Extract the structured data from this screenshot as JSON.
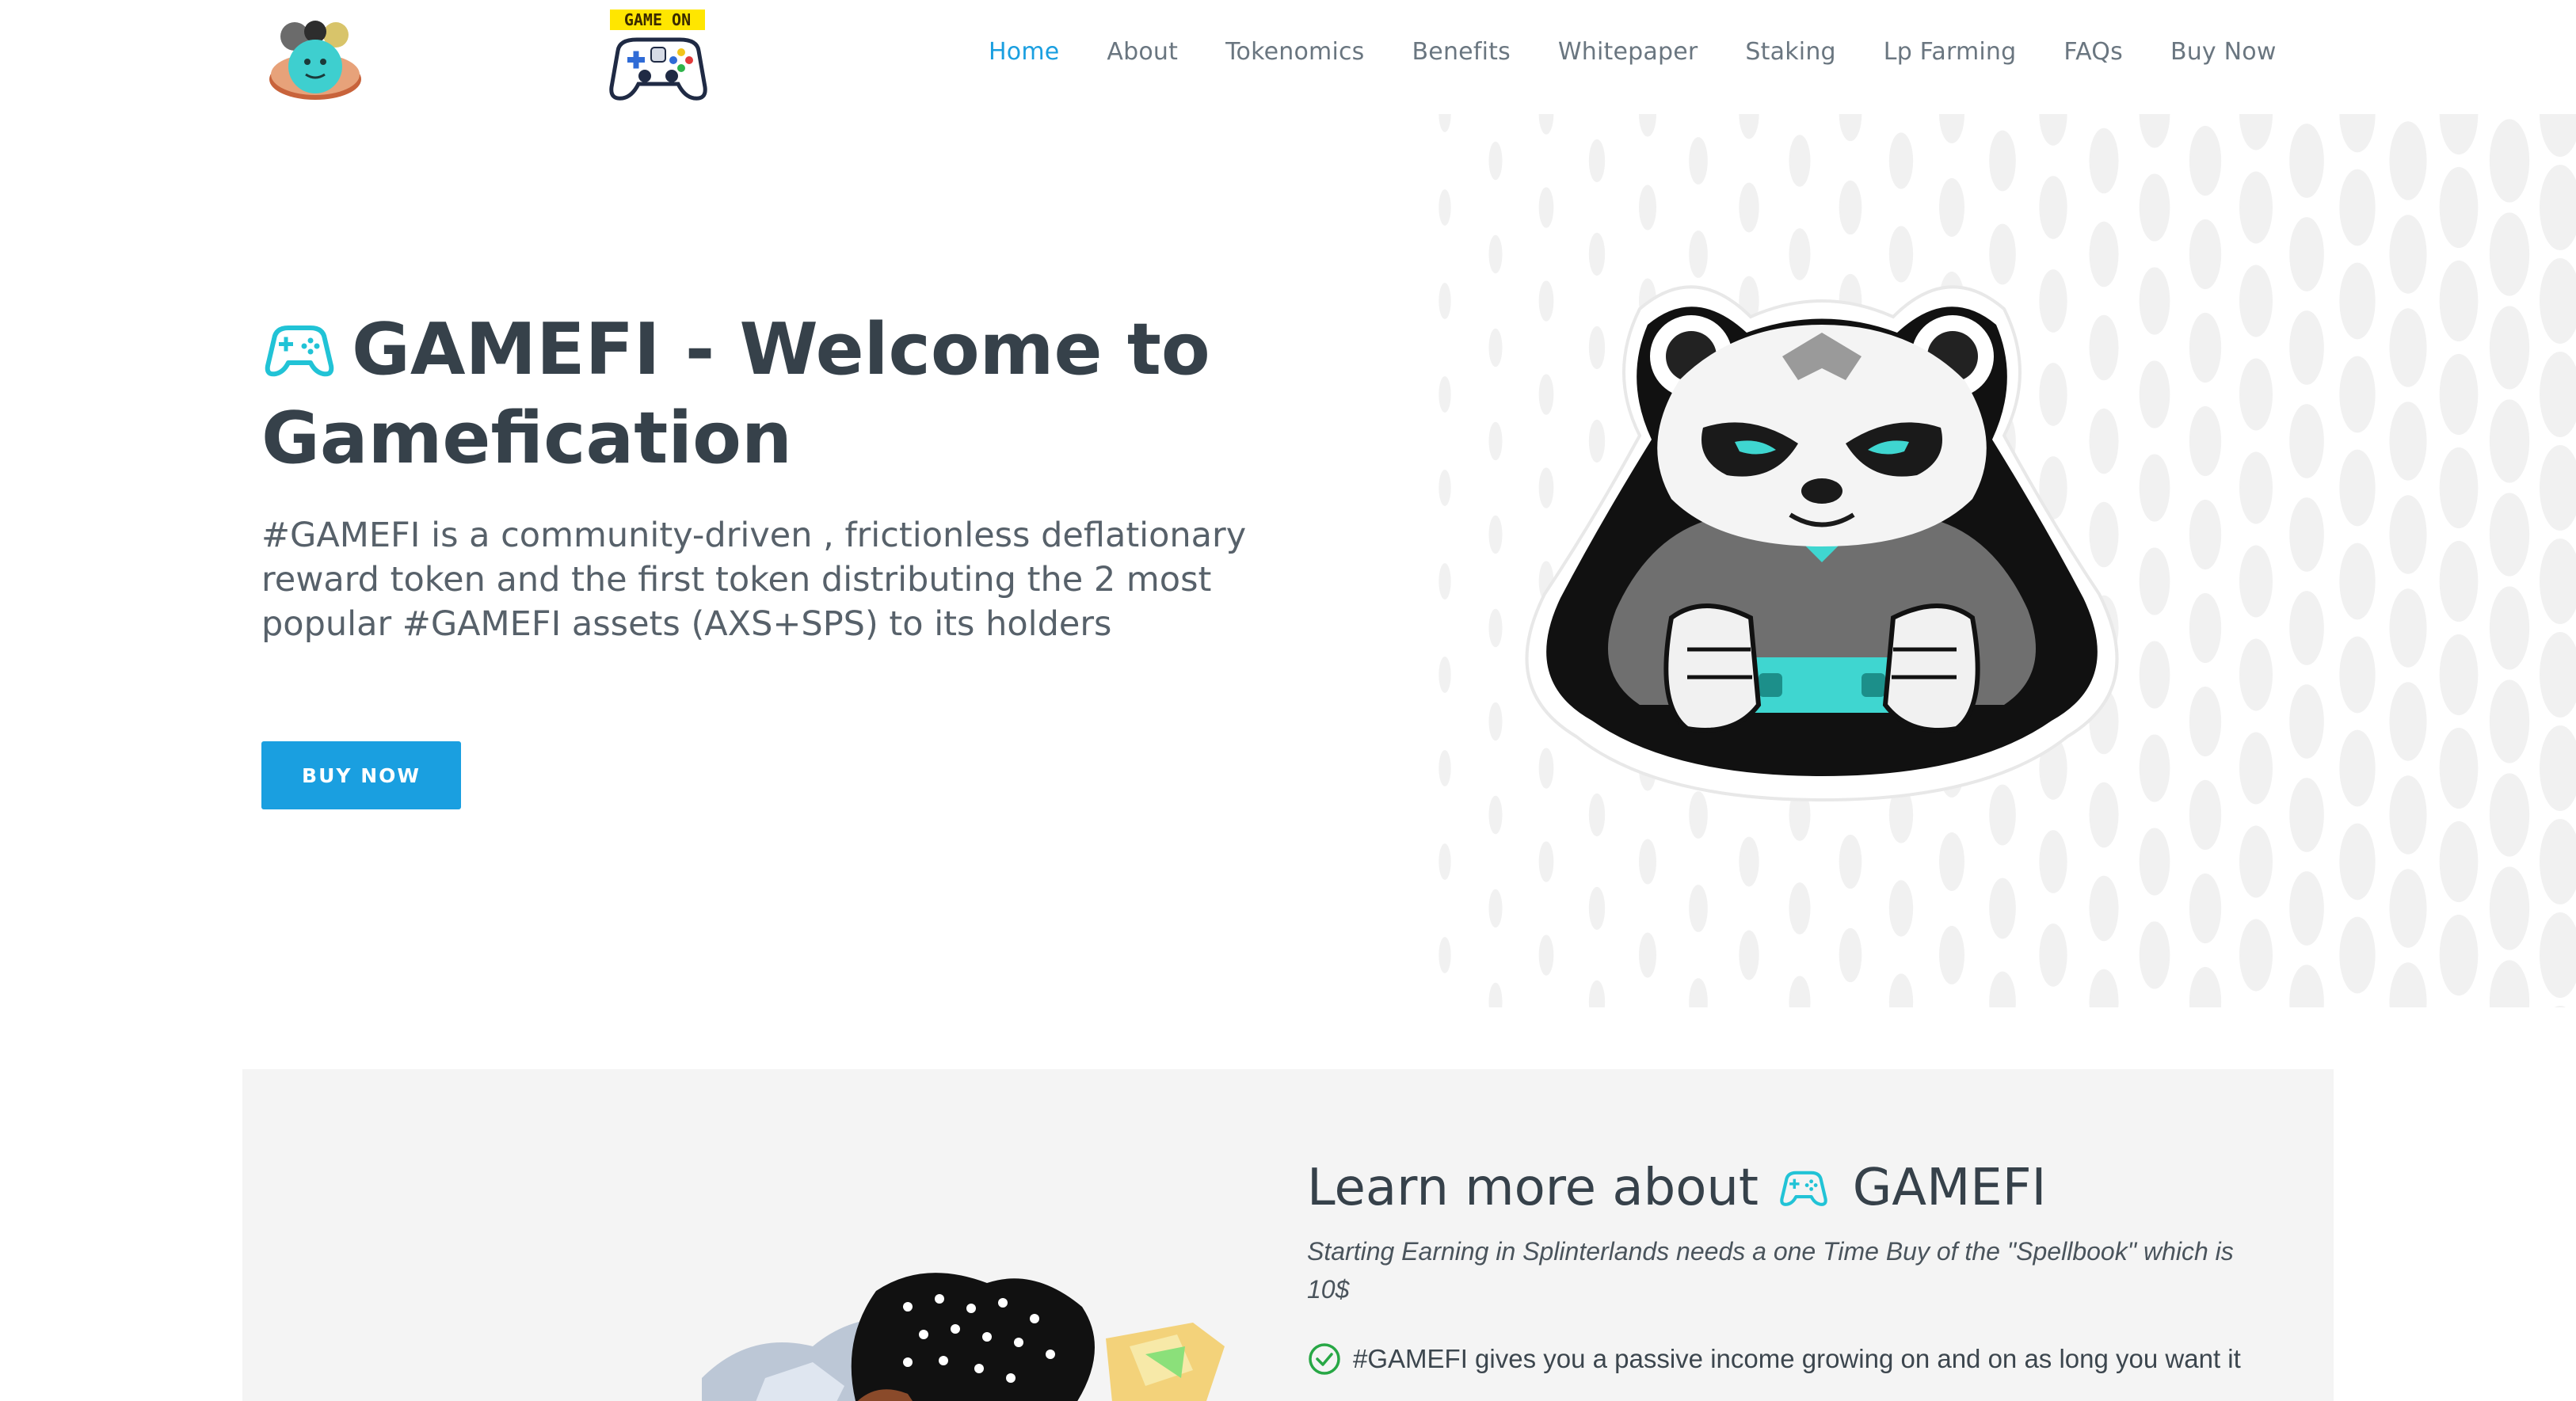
{
  "nav": {
    "items": [
      "Home",
      "About",
      "Tokenomics",
      "Benefits",
      "Whitepaper",
      "Staking",
      "Lp Farming",
      "FAQs",
      "Buy Now"
    ],
    "active": "Home"
  },
  "logo2": {
    "badge_text": "GAME ON"
  },
  "hero": {
    "title": "GAMEFI - Welcome to Gamefication",
    "description": "#GAMEFI is a community-driven , frictionless deflationary reward token and the first token distributing the 2 most popular #GAMEFI assets (AXS+SPS) to its holders",
    "button": "BUY NOW"
  },
  "learn": {
    "title_prefix": "Learn more about",
    "title_suffix": "GAMEFI",
    "subtitle": "Starting Earning in Splinterlands needs a one Time Buy of the \"Spellbook\" which is 10$",
    "items": [
      "#GAMEFI gives you a passive income growing on and on as long you want it"
    ]
  },
  "colors": {
    "accent": "#1a9fe0",
    "icon_teal": "#21c3d6",
    "check_green": "#27a745",
    "heading": "#36414a",
    "section_bg": "#f4f4f4"
  },
  "icons": [
    "gamepad-icon",
    "check-circle-icon",
    "panda-gamer-mascot",
    "game-on-controller-logo",
    "coin-pile-logo"
  ]
}
